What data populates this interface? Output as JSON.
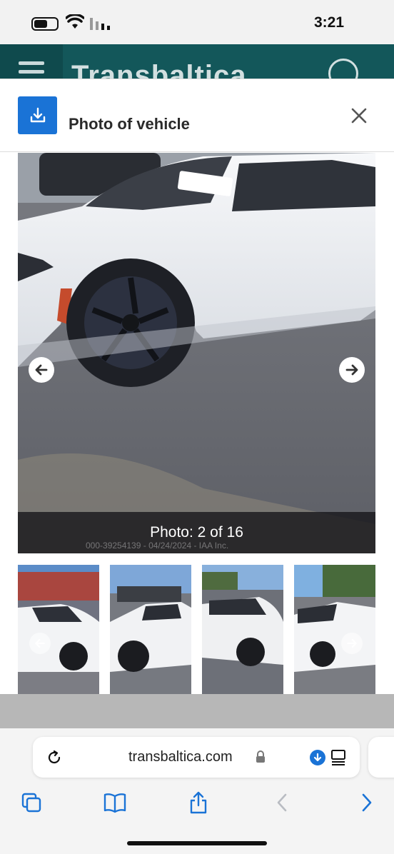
{
  "status_bar": {
    "time": "3:21",
    "icons": [
      "battery-icon",
      "wifi-icon",
      "cellular-signal-icon"
    ]
  },
  "site_header": {
    "brand": "Transbaltica",
    "colors": {
      "background": "#13575a"
    },
    "icons": [
      "hamburger-menu-icon",
      "user-account-icon"
    ]
  },
  "modal": {
    "title": "Photo of vehicle",
    "icons": [
      "download-icon",
      "close-icon"
    ],
    "accent_color": "#1a73d6"
  },
  "viewer": {
    "counter": "Photo: 2 of 16",
    "watermark": "000-39254139 - 04/24/2024 - IAA Inc.",
    "icons": [
      "arrow-left-icon",
      "arrow-right-icon"
    ]
  },
  "thumbnails": {
    "count_visible": 4,
    "icons": [
      "arrow-left-icon",
      "arrow-right-icon"
    ]
  },
  "browser": {
    "url": "transbaltica.com",
    "icons": [
      "reload-icon",
      "lock-icon",
      "download-icon",
      "reader-mode-icon",
      "tabs-icon",
      "bookmarks-icon",
      "share-icon",
      "back-icon",
      "forward-icon"
    ]
  }
}
